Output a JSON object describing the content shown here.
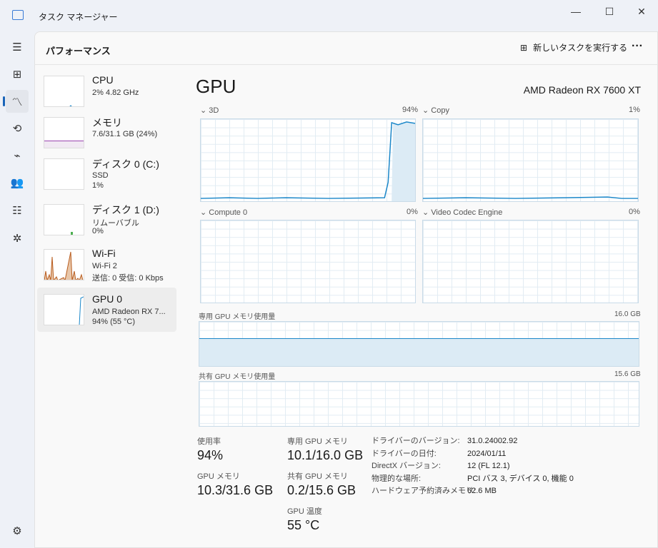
{
  "window": {
    "title": "タスク マネージャー",
    "minimize": "—",
    "maximize": "☐",
    "close": "✕"
  },
  "header": {
    "title": "パフォーマンス",
    "new_task": "新しいタスクを実行する",
    "more": "···"
  },
  "sidebar": [
    {
      "name": "CPU",
      "sub1": "2% 4.82 GHz",
      "sub2": ""
    },
    {
      "name": "メモリ",
      "sub1": "7.6/31.1 GB (24%)",
      "sub2": ""
    },
    {
      "name": "ディスク 0 (C:)",
      "sub1": "SSD",
      "sub2": "1%"
    },
    {
      "name": "ディスク 1 (D:)",
      "sub1": "リムーバブル",
      "sub2": "0%"
    },
    {
      "name": "Wi-Fi",
      "sub1": "Wi-Fi 2",
      "sub2": "送信: 0 受信: 0 Kbps"
    },
    {
      "name": "GPU 0",
      "sub1": "AMD Radeon RX 7...",
      "sub2": "94% (55 °C)"
    }
  ],
  "gpu": {
    "title": "GPU",
    "model": "AMD Radeon RX 7600 XT",
    "engines": [
      {
        "name": "3D",
        "value": "94%"
      },
      {
        "name": "Copy",
        "value": "1%"
      },
      {
        "name": "Compute 0",
        "value": "0%"
      },
      {
        "name": "Video Codec Engine",
        "value": "0%"
      }
    ],
    "dedicated_label": "専用 GPU メモリ使用量",
    "dedicated_max": "16.0 GB",
    "dedicated_fraction": 0.63,
    "shared_label": "共有 GPU メモリ使用量",
    "shared_max": "15.6 GB",
    "stats": {
      "util_label": "使用率",
      "util": "94%",
      "gpumem_label": "GPU メモリ",
      "gpumem": "10.3/31.6 GB",
      "ded_label": "専用 GPU メモリ",
      "ded": "10.1/16.0 GB",
      "shared_label": "共有 GPU メモリ",
      "shared": "0.2/15.6 GB",
      "temp_label": "GPU 温度",
      "temp": "55 °C"
    },
    "details": [
      {
        "label": "ドライバーのバージョン:",
        "value": "31.0.24002.92"
      },
      {
        "label": "ドライバーの日付:",
        "value": "2024/01/11"
      },
      {
        "label": "DirectX バージョン:",
        "value": "12 (FL 12.1)"
      },
      {
        "label": "物理的な場所:",
        "value": "PCI バス 3, デバイス 0, 機能 0"
      },
      {
        "label": "ハードウェア予約済みメモリ:",
        "value": "62.6 MB"
      }
    ]
  },
  "colors": {
    "gpu": "#1b87c9",
    "memory": "#9b45b0",
    "disk": "#4caf50",
    "wifi": "#b85c1e"
  }
}
